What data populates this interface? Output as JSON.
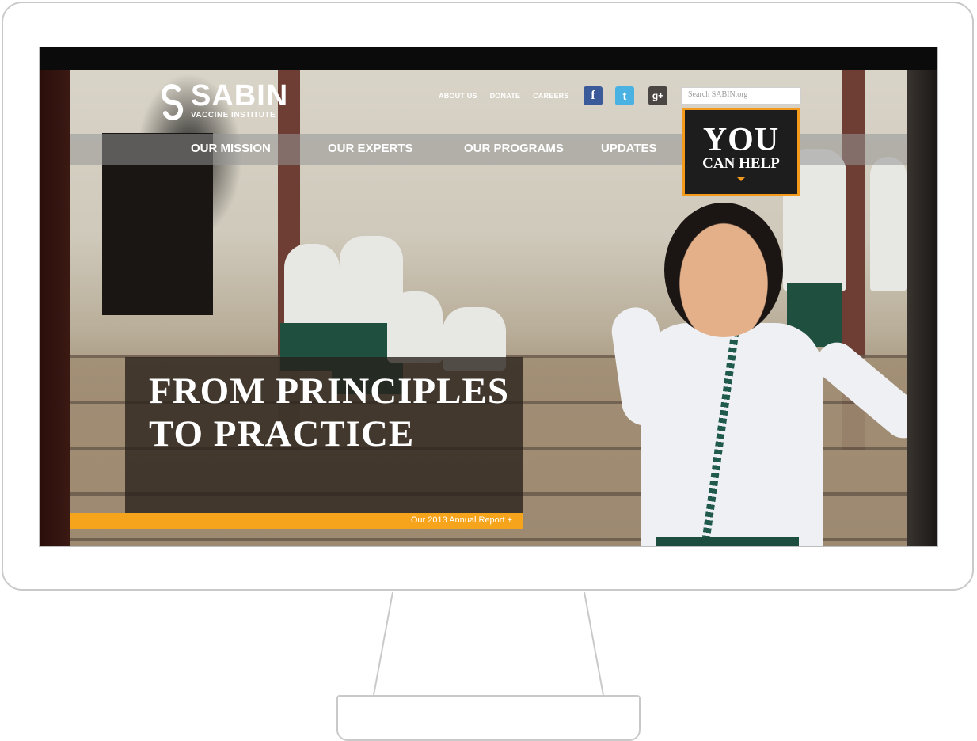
{
  "brand": {
    "name": "SABIN",
    "subtitle": "VACCINE INSTITUTE"
  },
  "utility_nav": {
    "items": [
      "ABOUT US",
      "DONATE",
      "CAREERS"
    ]
  },
  "social": [
    {
      "icon": "facebook-icon",
      "glyph": "f"
    },
    {
      "icon": "twitter-icon",
      "glyph": "t"
    },
    {
      "icon": "google-plus-icon",
      "glyph": "g+"
    }
  ],
  "search": {
    "placeholder": "Search SABIN.org"
  },
  "main_nav": {
    "items": [
      "OUR MISSION",
      "OUR EXPERTS",
      "OUR PROGRAMS",
      "UPDATES"
    ]
  },
  "cta": {
    "line1": "YOU",
    "line2": "CAN HELP"
  },
  "hero": {
    "title": "FROM PRINCIPLES TO PRACTICE",
    "link": "Our 2013 Annual Report +"
  },
  "colors": {
    "accent": "#f39a1c",
    "facebook": "#3b5a9a",
    "twitter": "#4ab2e3"
  }
}
